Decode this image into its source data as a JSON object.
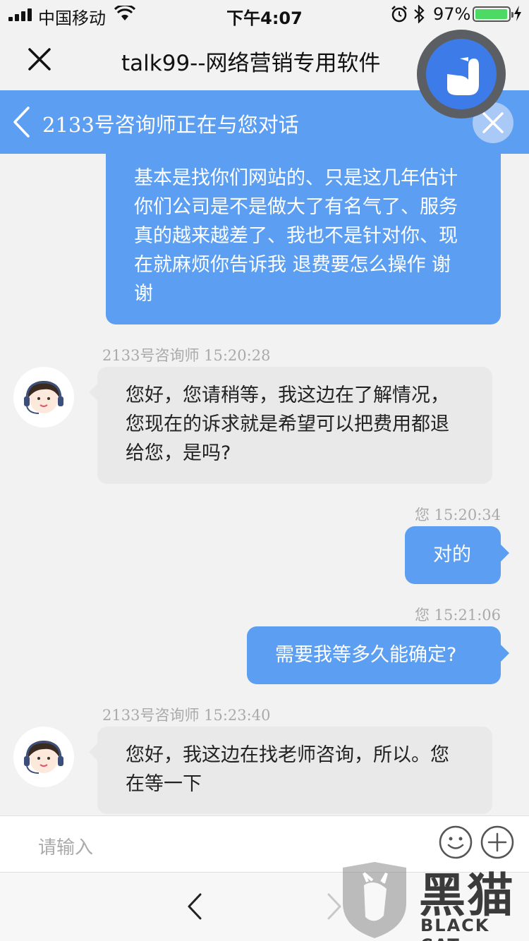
{
  "status_bar": {
    "carrier": "中国移动",
    "time": "下午4:07",
    "battery_percent": "97%",
    "battery_level": 0.97,
    "icons": [
      "signal-icon",
      "wifi-icon",
      "alarm-icon",
      "bluetooth-icon",
      "battery-icon",
      "charging-icon"
    ]
  },
  "nav": {
    "title": "talk99--网络营销专用软件",
    "close_icon": "close-icon",
    "logo_icon": "duck-logo-icon"
  },
  "chat_header": {
    "title": "2133号咨询师正在与您对话",
    "back_icon": "chevron-left-icon",
    "close_icon": "close-icon"
  },
  "messages": [
    {
      "sender": "user",
      "text": "基本是找你们网站的、只是这几年估计\n你们公司是不是做大了有名气了、服务\n真的越来越差了、我也不是针对你、现\n在就麻烦你告诉我 退费要怎么操作 谢\n谢",
      "partial_top": true
    },
    {
      "sender": "agent",
      "meta": "2133号咨询师  15:20:28",
      "text": "您好，您请稍等，我这边在了解情况，\n您现在的诉求就是希望可以把费用都退\n给您，是吗?"
    },
    {
      "sender": "user",
      "meta": "您  15:20:34",
      "text": "对的"
    },
    {
      "sender": "user",
      "meta": "您  15:21:06",
      "text": "需要我等多久能确定?"
    },
    {
      "sender": "agent",
      "meta": "2133号咨询师  15:23:40",
      "text": "您好，我这边在找老师咨询，所以。您\n在等一下"
    }
  ],
  "input": {
    "placeholder": "请输入",
    "emoji_icon": "smiley-icon",
    "plus_icon": "plus-icon"
  },
  "toolbar": {
    "back_icon": "chevron-left-icon",
    "forward_icon": "chevron-right-icon"
  },
  "watermark": {
    "name_cn": "黑猫",
    "name_en": "BLACK CAT"
  },
  "colors": {
    "accent_blue": "#5c9ff2",
    "agent_bubble": "#e9e9e9",
    "background": "#f2f2f2",
    "meta_text": "#aaaaaa",
    "battery_green": "#4cd964"
  }
}
